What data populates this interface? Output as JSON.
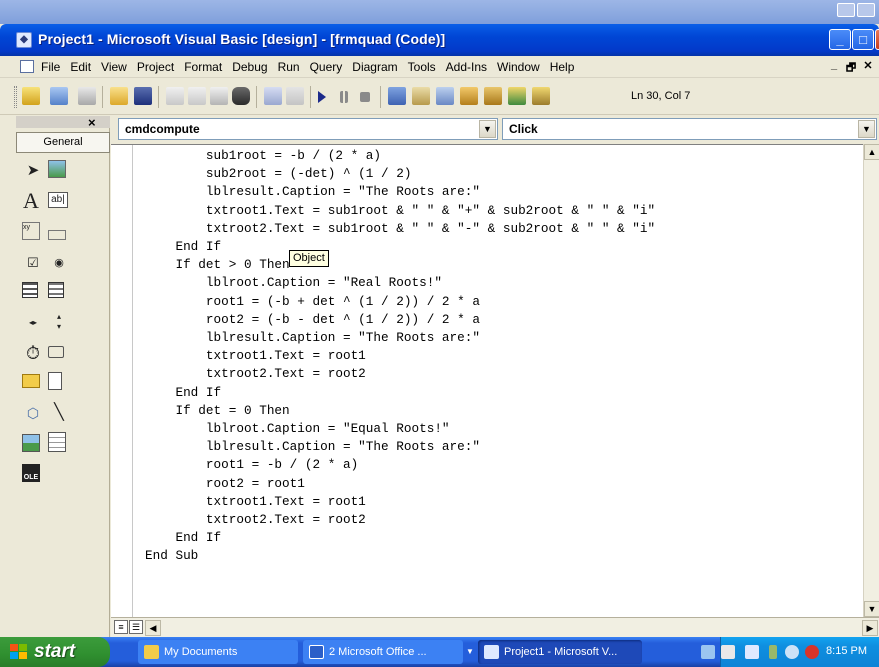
{
  "window": {
    "title": "Project1 - Microsoft Visual Basic [design] - [frmquad (Code)]",
    "min_glyph": "_",
    "max_glyph": "□",
    "close_glyph": "✕"
  },
  "menu": {
    "items": [
      "File",
      "Edit",
      "View",
      "Project",
      "Format",
      "Debug",
      "Run",
      "Query",
      "Diagram",
      "Tools",
      "Add-Ins",
      "Window",
      "Help"
    ],
    "mdi_min": "_",
    "mdi_restore": "🗗",
    "mdi_close": "✕"
  },
  "toolbar": {
    "position": "Ln 30, Col 7",
    "icons": [
      "add-project-icon",
      "add-form-icon",
      "menu-editor-icon",
      "open-icon",
      "save-icon",
      "cut-icon",
      "copy-icon",
      "paste-icon",
      "find-icon",
      "undo-icon",
      "redo-icon",
      "run-icon",
      "break-icon",
      "stop-icon",
      "project-explorer-icon",
      "properties-icon",
      "form-layout-icon",
      "object-browser-icon",
      "toolbox-icon",
      "data-view-icon",
      "component-manager-icon"
    ]
  },
  "toolbox": {
    "tab": "General",
    "close": "×",
    "tools": [
      "pointer-icon",
      "picturebox-icon",
      "label-icon",
      "textbox-icon",
      "frame-icon",
      "commandbutton-icon",
      "checkbox-icon",
      "optionbutton-icon",
      "combobox-icon",
      "listbox-icon",
      "hscrollbar-icon",
      "vscrollbar-icon",
      "timer-icon",
      "drivelistbox-icon",
      "dirlistbox-icon",
      "filelistbox-icon",
      "shape-icon",
      "line-icon",
      "image-icon",
      "data-icon",
      "ole-icon"
    ]
  },
  "editor": {
    "object_combo": "cmdcompute",
    "procedure_combo": "Click",
    "tooltip": "Object",
    "code_lines": [
      "        sub1root = -b / (2 * a)",
      "        sub2root = (-det) ^ (1 / 2)",
      "        lblresult.Caption = \"The Roots are:\"",
      "        txtroot1.Text = sub1root & \" \" & \"+\" & sub2root & \" \" & \"i\"",
      "        txtroot2.Text = sub1root & \" \" & \"-\" & sub2root & \" \" & \"i\"",
      "    End If",
      "    If det > 0 Then",
      "        lblroot.Caption = \"Real Roots!\"",
      "        root1 = (-b + det ^ (1 / 2)) / 2 * a",
      "        root2 = (-b - det ^ (1 / 2)) / 2 * a",
      "        lblresult.Caption = \"The Roots are:\"",
      "        txtroot1.Text = root1",
      "        txtroot2.Text = root2",
      "    End If",
      "    If det = 0 Then",
      "        lblroot.Caption = \"Equal Roots!\"",
      "        lblresult.Caption = \"The Roots are:\"",
      "        root1 = -b / (2 * a)",
      "        root2 = root1",
      "        txtroot1.Text = root1",
      "        txtroot2.Text = root2",
      "    End If",
      "End Sub"
    ]
  },
  "taskbar": {
    "start": "start",
    "tasks": [
      "My Documents",
      "2 Microsoft Office ...",
      "Project1 - Microsoft V..."
    ],
    "clock": "8:15 PM"
  },
  "colors": {
    "titlebar": "#0046d5",
    "taskbar": "#245edb",
    "start_button": "#2f8f2f",
    "tray": "#0f8fe0"
  }
}
